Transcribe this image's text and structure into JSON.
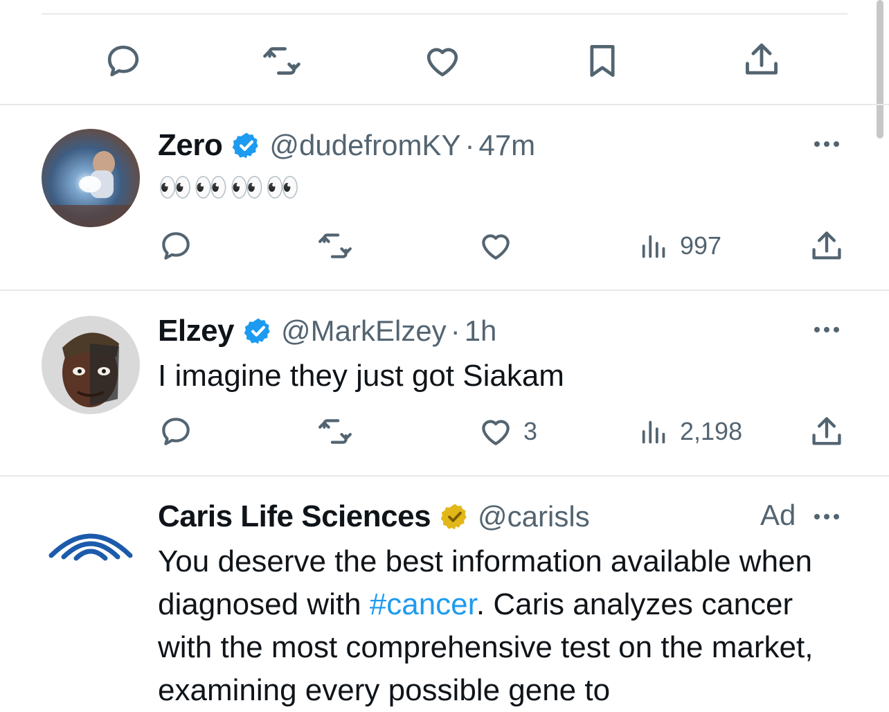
{
  "top_action_bar": {
    "icons": [
      "reply-icon",
      "retweet-icon",
      "like-icon",
      "bookmark-icon",
      "share-icon"
    ]
  },
  "tweets": [
    {
      "display_name": "Zero",
      "handle": "@dudefromKY",
      "separator": "·",
      "time": "47m",
      "text": "👀👀👀👀",
      "verified": "blue",
      "views": "997",
      "likes": ""
    },
    {
      "display_name": "Elzey",
      "handle": "@MarkElzey",
      "separator": "·",
      "time": "1h",
      "text": "I imagine they just got Siakam",
      "verified": "blue",
      "views": "2,198",
      "likes": "3"
    },
    {
      "display_name": "Caris Life Sciences",
      "handle": "@carisls",
      "ad_label": "Ad",
      "verified": "gold",
      "text_before_hashtag": "You deserve the best information available when diagnosed with ",
      "hashtag": "#cancer",
      "text_after_hashtag": ". Caris analyzes cancer with the most comprehensive test on the market, examining every possible gene to"
    }
  ],
  "colors": {
    "icon_gray": "#536471",
    "verified_blue": "#1d9bf0",
    "verified_gold": "#e2b719",
    "link_blue": "#1d9bf0",
    "divider": "#e7e9ea"
  }
}
